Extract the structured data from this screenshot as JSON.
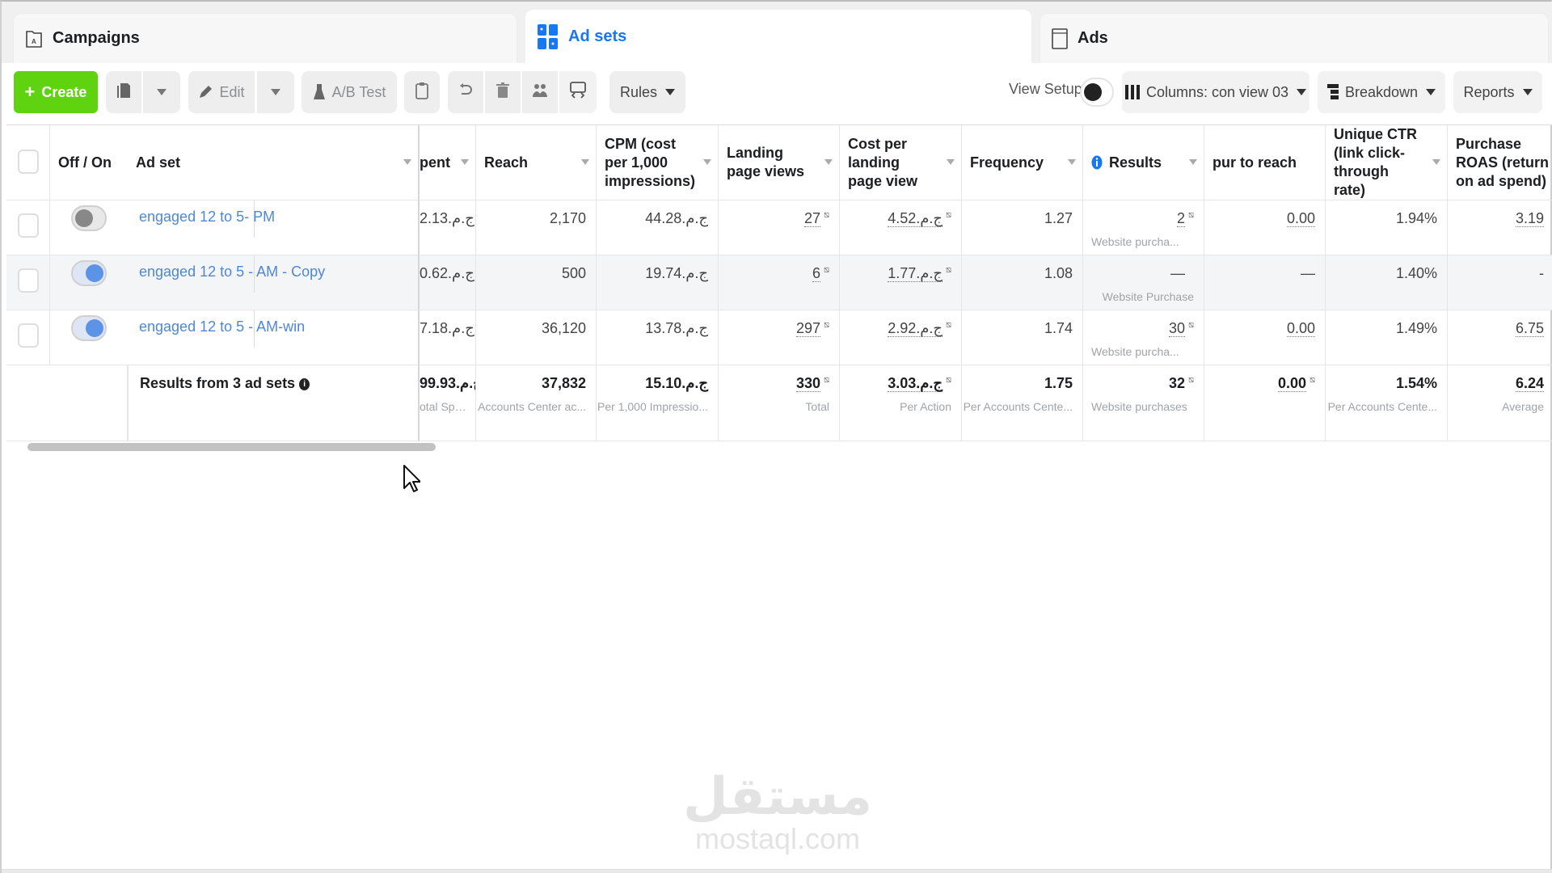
{
  "tabs": [
    {
      "label": "Campaigns",
      "icon": "folder-icon",
      "active": false
    },
    {
      "label": "Ad sets",
      "icon": "grid-icon",
      "active": true
    },
    {
      "label": "Ads",
      "icon": "ad-page-icon",
      "active": false
    }
  ],
  "toolbar": {
    "create_label": "Create",
    "edit_label": "Edit",
    "ab_test_label": "A/B Test",
    "rules_label": "Rules",
    "view_setup_label": "View Setup",
    "columns_label": "Columns: con view 03",
    "breakdown_label": "Breakdown",
    "reports_label": "Reports"
  },
  "table": {
    "columns": {
      "off_on": "Off / On",
      "ad_set": "Ad set",
      "spent": "pent",
      "reach": "Reach",
      "cpm": "CPM (cost per 1,000 impressions)",
      "lpv": "Landing page views",
      "cost_lpv": "Cost per landing page view",
      "frequency": "Frequency",
      "results": "Results",
      "pur_to_reach": "pur to reach",
      "unique_ctr": "Unique CTR (link click-through rate)",
      "roas": "Purchase ROAS (return on ad spend)"
    },
    "rows": [
      {
        "enabled": false,
        "name": "engaged 12 to 5- PM",
        "spent": "2.13.ج.م",
        "reach": "2,170",
        "cpm": "44.28.ج.م",
        "lpv": "27",
        "cost_lpv": "4.52.ج.م",
        "frequency": "1.27",
        "results": "2",
        "results_sub": "Website purcha...",
        "pur_to_reach": "0.00",
        "unique_ctr": "1.94%",
        "roas": "3.19"
      },
      {
        "enabled": true,
        "name": "engaged 12 to 5 - AM - Copy",
        "spent": "0.62.ج.م",
        "reach": "500",
        "cpm": "19.74.ج.م",
        "lpv": "6",
        "cost_lpv": "1.77.ج.م",
        "frequency": "1.08",
        "results": "—",
        "results_sub": "Website Purchase",
        "pur_to_reach": "—",
        "unique_ctr": "1.40%",
        "roas": "-"
      },
      {
        "enabled": true,
        "name": "engaged 12 to 5 - AM-win",
        "spent": "7.18.ج.م",
        "reach": "36,120",
        "cpm": "13.78.ج.م",
        "lpv": "297",
        "cost_lpv": "2.92.ج.م",
        "frequency": "1.74",
        "results": "30",
        "results_sub": "Website purcha...",
        "pur_to_reach": "0.00",
        "unique_ctr": "1.49%",
        "roas": "6.75"
      }
    ],
    "summary": {
      "label": "Results from 3 ad sets",
      "spent": "99.93.ج.م",
      "spent_sub": "otal Spent",
      "reach": "37,832",
      "reach_sub": "Accounts Center ac...",
      "cpm": "15.10.ج.م",
      "cpm_sub": "Per 1,000 Impressio...",
      "lpv": "330",
      "lpv_sub": "Total",
      "cost_lpv": "3.03.ج.م",
      "cost_lpv_sub": "Per Action",
      "frequency": "1.75",
      "frequency_sub": "Per Accounts Cente...",
      "results": "32",
      "results_sub": "Website purchases",
      "pur_to_reach": "0.00",
      "unique_ctr": "1.54%",
      "unique_ctr_sub": "Per Accounts Cente...",
      "roas": "6.24",
      "roas_sub": "Average"
    }
  },
  "watermark": {
    "arabic": "مستقل",
    "latin": "mostaql.com"
  },
  "colors": {
    "accent": "#1877f2",
    "create": "#5fd310",
    "link": "#4f87d8"
  }
}
